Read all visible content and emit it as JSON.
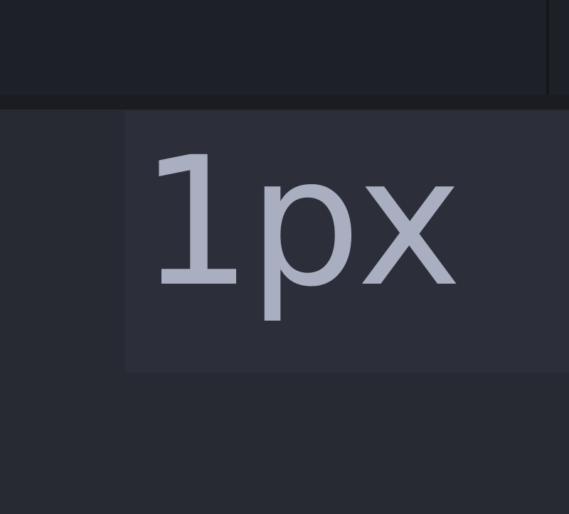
{
  "value_field": {
    "value": "1px"
  },
  "colors": {
    "toolbar_bg": "#1e2028",
    "panel_bg": "#272a33",
    "field_bg": "#2c2f3a",
    "text": "#a9afc0"
  }
}
